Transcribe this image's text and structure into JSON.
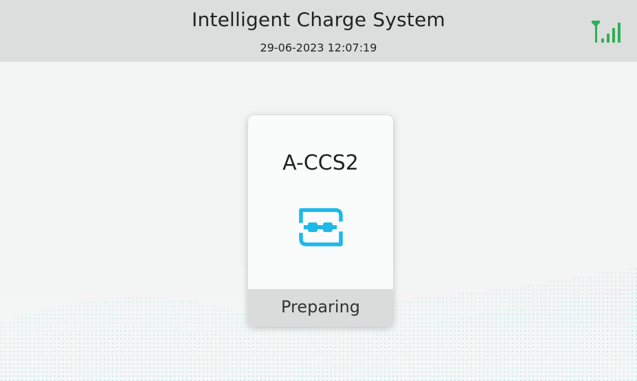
{
  "header": {
    "title": "Intelligent Charge System",
    "datetime": "29-06-2023 12:07:19",
    "signal_icon": "signal-strength-icon",
    "signal_color": "#2fae55"
  },
  "connector": {
    "name": "A-CCS2",
    "status": "Preparing",
    "icon": "plug-connection-icon",
    "icon_color": "#1fb8e8"
  },
  "colors": {
    "header_bg": "#dcdddd",
    "screen_bg": "#f2f3f3",
    "card_bg": "#fafbfb",
    "status_bar_bg": "#dadbdb",
    "wave_accent": "#7fd8e0"
  }
}
